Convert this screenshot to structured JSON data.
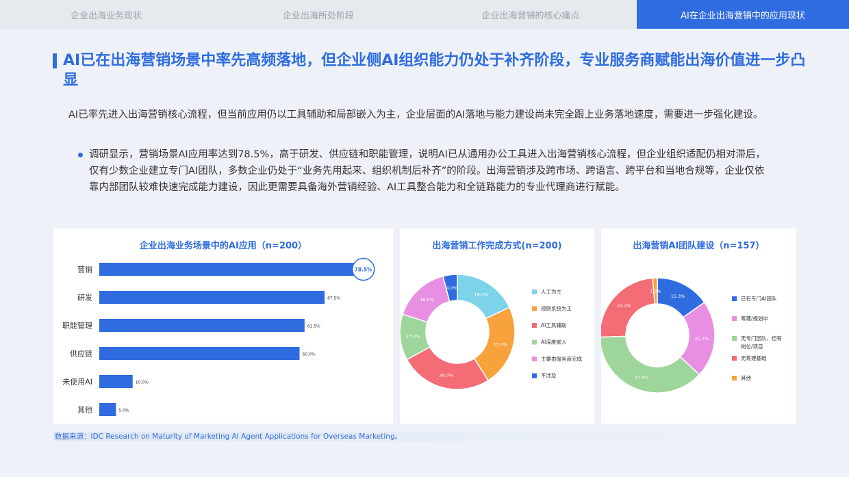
{
  "tabs": [
    {
      "label": "企业出海业务现状"
    },
    {
      "label": "企业出海所处阶段"
    },
    {
      "label": "企业出海营销的核心痛点"
    },
    {
      "label": "AI在企业出海营销中的应用现状"
    }
  ],
  "title": "AI已在出海营销场景中率先高频落地，但企业侧AI组织能力仍处于补齐阶段，专业服务商赋能出海价值进一步凸显",
  "intro": "AI已率先进入出海营销核心流程，但当前应用仍以工具辅助和局部嵌入为主，企业层面的AI落地与能力建设尚未完全跟上业务落地速度，需要进一步强化建设。",
  "bullet": "调研显示，营销场景AI应用率达到78.5%，高于研发、供应链和职能管理，说明AI已从通用办公工具进入出海营销核心流程，但企业组织适配仍相对滞后，仅有少数企业建立专门AI团队，多数企业仍处于“业务先用起来、组织机制后补齐”的阶段。出海营销涉及跨市场、跨语言、跨平台和当地合规等，企业仅依靠内部团队较难快速完成能力建设，因此更需要具备海外营销经验、AI工具整合能力和全链路能力的专业代理商进行赋能。",
  "source": "数据来源：IDC Research on Maturity of Marketing AI Agent Applications for Overseas Marketing。",
  "colors": {
    "accent": "#2f6ce0"
  },
  "chart_data": [
    {
      "type": "bar",
      "title": "企业出海业务场景中的AI应用（n=200）",
      "categories": [
        "营销",
        "研发",
        "职能管理",
        "供应链",
        "未使用AI",
        "其他"
      ],
      "values": [
        78.5,
        67.5,
        61.5,
        60.0,
        10.0,
        5.0
      ],
      "value_labels": [
        "78.5%",
        "67.5%",
        "61.5%",
        "60.0%",
        "10.0%",
        "5.0%"
      ],
      "highlight": "营销",
      "color": "#2f6ce0"
    },
    {
      "type": "pie",
      "title": "出海营销工作完成方式(n=200)",
      "labels": [
        "人工为主",
        "规则系统为主",
        "AI工具辅助",
        "AI深度嵌入",
        "主要由服务商完成",
        "不涉及"
      ],
      "values": [
        18.0,
        23.0,
        26.0,
        13.0,
        16.0,
        4.0
      ],
      "value_labels": [
        "18.0%",
        "23.0%",
        "26.0%",
        "13.0%",
        "16.0%",
        "4.0%"
      ],
      "colors": [
        "#7dd3ea",
        "#f7a23b",
        "#f46c75",
        "#9ed59a",
        "#e88fe4",
        "#2f6ce0"
      ]
    },
    {
      "type": "pie",
      "title": "出海营销AI团队建设（n=157）",
      "labels": [
        "已有专门AI团队",
        "筹建/规划中",
        "无专门团队，但有岗位/项目",
        "无筹建基础",
        "其他"
      ],
      "values": [
        15.3,
        21.7,
        37.6,
        24.2,
        1.3
      ],
      "value_labels": [
        "15.3%",
        "21.7%",
        "37.6%",
        "24.2%",
        "1.3%"
      ],
      "colors": [
        "#2f6ce0",
        "#e88fe4",
        "#9ed59a",
        "#f46c75",
        "#f7a23b"
      ]
    }
  ]
}
